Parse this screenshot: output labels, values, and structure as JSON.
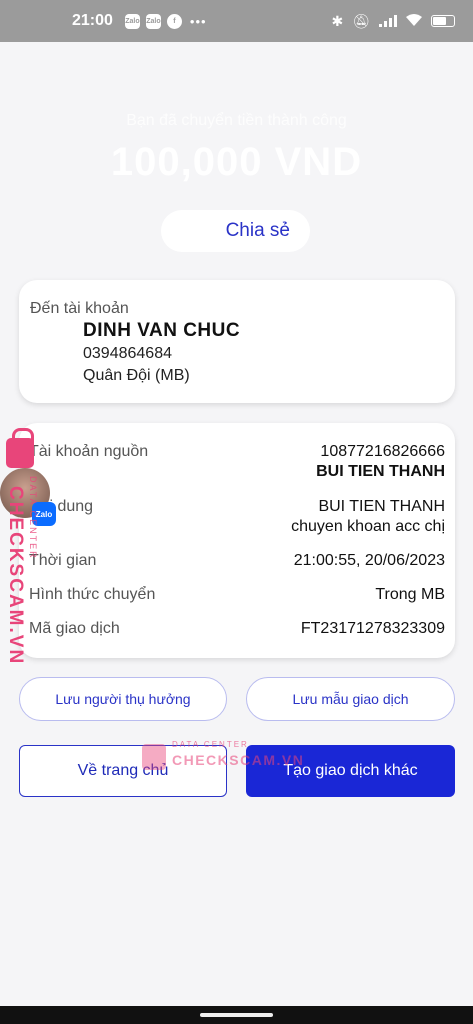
{
  "status_bar": {
    "time": "21:00",
    "notif_icons": [
      "Zalo",
      "Zalo",
      "facebook-icon"
    ],
    "more": "•••",
    "right_icons": [
      "bluetooth-icon",
      "mute-icon",
      "signal-icon",
      "wifi-icon",
      "battery-icon"
    ]
  },
  "header": {
    "subtitle": "Bạn đã chuyển tiền thành công",
    "amount": "100,000 VND"
  },
  "share": {
    "label": "Chia sẻ"
  },
  "destination": {
    "label": "Đến tài khoản",
    "name": "DINH VAN CHUC",
    "account": "0394864684",
    "bank": "Quân Đội (MB)"
  },
  "details": {
    "source_label": "Tài khoản nguồn",
    "source_account": "10877216826666",
    "source_name": "BUI TIEN THANH",
    "content_label": "Nội dung",
    "content_line1": "BUI TIEN THANH",
    "content_line2": "chuyen khoan acc chị",
    "time_label": "Thời gian",
    "time_value": "21:00:55, 20/06/2023",
    "method_label": "Hình thức chuyển",
    "method_value": "Trong MB",
    "txn_label": "Mã giao dịch",
    "txn_value": "FT23171278323309"
  },
  "actions": {
    "save_beneficiary": "Lưu người thụ hưởng",
    "save_template": "Lưu mẫu giao dịch",
    "home": "Về trang chủ",
    "new_transaction": "Tạo giao dịch khác"
  },
  "watermark": {
    "brand": "CHECKSCAM.VN",
    "small": "DATA CENTER",
    "zalo": "Zalo"
  },
  "colors": {
    "primary": "#1a27d6",
    "status_bar": "#9b9b9b",
    "watermark": "#e8457a"
  }
}
